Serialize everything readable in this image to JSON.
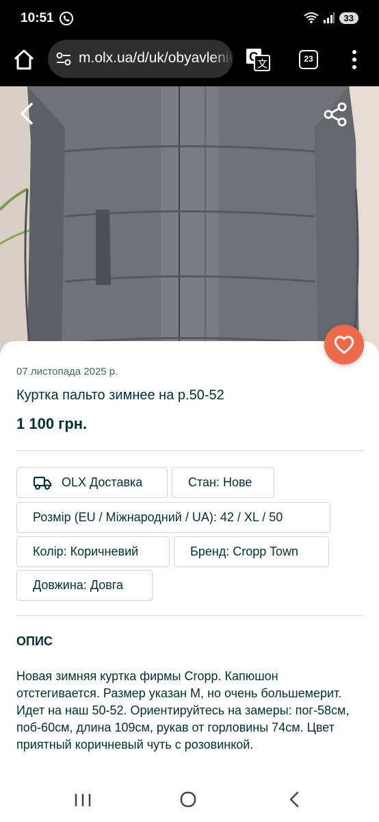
{
  "status_bar": {
    "time": "10:51",
    "battery": "33",
    "icons": [
      "viber-icon",
      "wifi-icon",
      "signal-icon",
      "battery-icon"
    ]
  },
  "browser": {
    "url": "m.olx.ua/d/uk/obyavlenie",
    "tab_count": "23",
    "icons": [
      "home-icon",
      "site-settings-icon",
      "translate-icon",
      "tabs-icon",
      "more-vert-icon"
    ]
  },
  "listing": {
    "date": "07 листопада 2025 р.",
    "title": "Куртка пальто зимнее на р.50-52",
    "price": "1 100 грн.",
    "accent_color": "#ef6a4a",
    "text_color": "#002f34"
  },
  "params": {
    "delivery": "OLX Доставка",
    "condition": "Стан: Нове",
    "size": "Розмір (EU / Міжнародний / UA): 42 / XL / 50",
    "color": "Колір: Коричневий",
    "brand": "Бренд: Cropp Town",
    "length": "Довжина: Довга"
  },
  "description": {
    "heading": "ОПИС",
    "text": "Новая зимняя куртка фирмы Cropp. Капюшон отстегивается. Размер указан М, но очень большемерит. Идет на наш 50-52. Ориентируйтесь на замеры: пог-58см, поб-60см, длина 109см, рукав от горловины 74см. Цвет приятный коричневый чуть с розовинкой."
  },
  "system_nav": {
    "icons": [
      "recent-apps-icon",
      "home-circle-icon",
      "back-chevron-icon"
    ]
  }
}
